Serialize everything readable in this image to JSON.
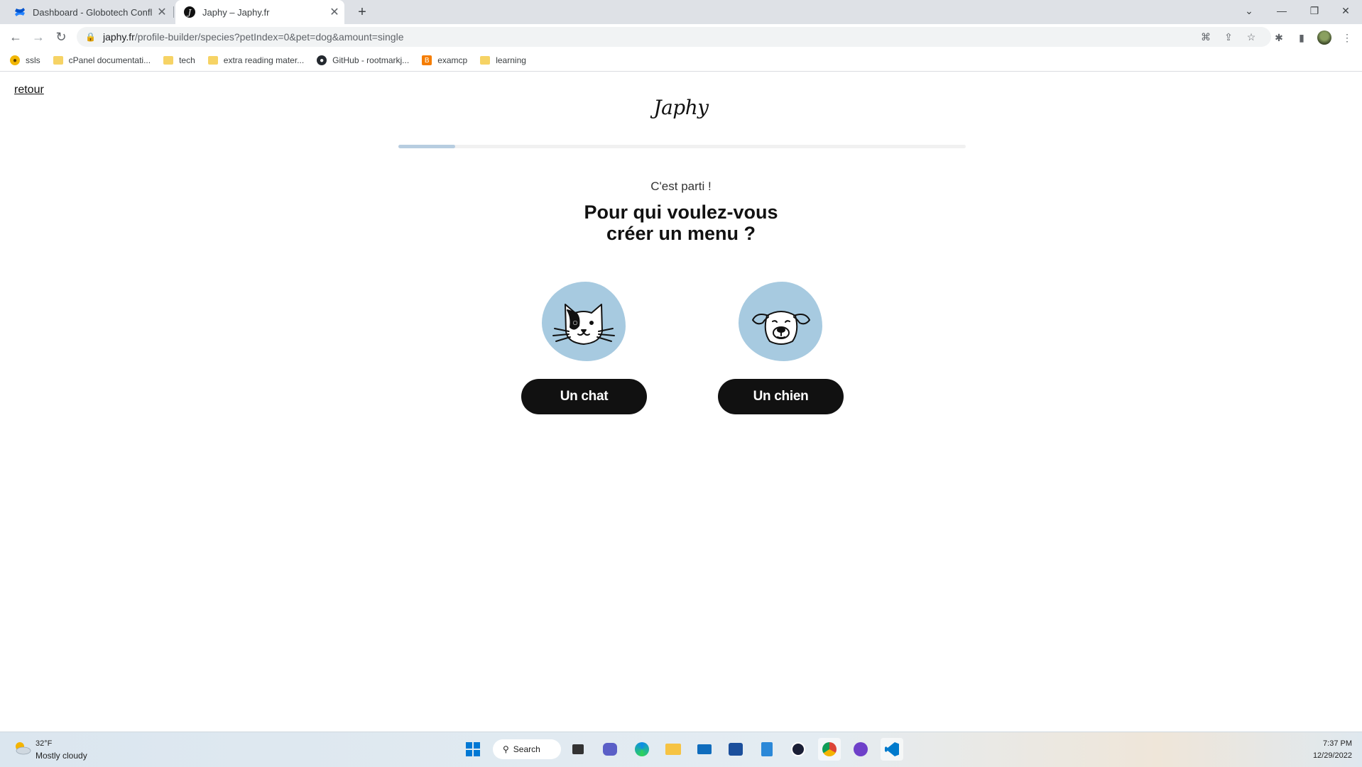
{
  "browser": {
    "tabs": [
      {
        "title": "Dashboard - Globotech Confluen",
        "favicon": "confluence-icon",
        "active": false
      },
      {
        "title": "Japhy – Japhy.fr",
        "favicon": "japhy-icon",
        "active": true
      }
    ],
    "url_host": "japhy.fr",
    "url_path": "/profile-builder/species?petIndex=0&pet=dog&amount=single",
    "bookmarks": [
      {
        "label": "ssls",
        "icon": "ssls-icon"
      },
      {
        "label": "cPanel documentati...",
        "icon": "folder-icon"
      },
      {
        "label": "tech",
        "icon": "folder-icon"
      },
      {
        "label": "extra reading mater...",
        "icon": "folder-icon"
      },
      {
        "label": "GitHub - rootmarkj...",
        "icon": "github-icon"
      },
      {
        "label": "examcp",
        "icon": "blogger-icon"
      },
      {
        "label": "learning",
        "icon": "folder-icon"
      }
    ]
  },
  "page": {
    "back_label": "retour",
    "logo": "Japhy",
    "progress_fraction": 0.1,
    "kicker": "C'est parti !",
    "heading_line1": "Pour qui voulez-vous",
    "heading_line2": "créer un menu ?",
    "options": [
      {
        "label": "Un chat",
        "illustration": "cat-face-icon"
      },
      {
        "label": "Un chien",
        "illustration": "dog-face-icon"
      }
    ],
    "colors": {
      "blob": "#a7cae0",
      "button": "#111111",
      "progress": "#b7cde0"
    }
  },
  "taskbar": {
    "weather_temp": "32°F",
    "weather_desc": "Mostly cloudy",
    "search_label": "Search",
    "time": "7:37 PM",
    "date": "12/29/2022"
  }
}
